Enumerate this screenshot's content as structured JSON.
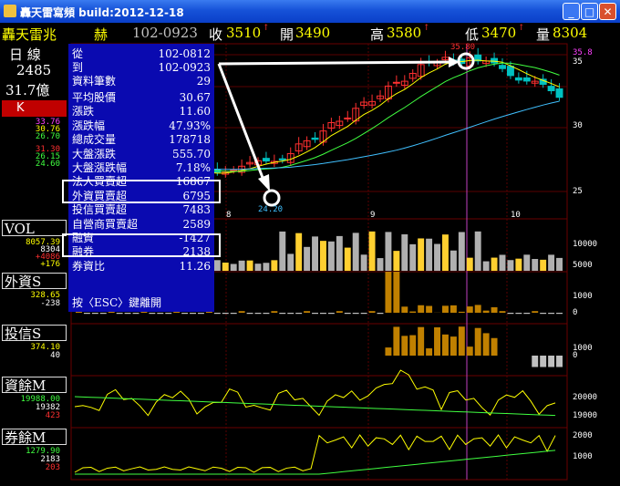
{
  "window": {
    "title": "轟天雷寫頻 build:2012-12-18",
    "min": "_",
    "max": "□",
    "close": "✕"
  },
  "quote": {
    "name": "轟天雷兆",
    "code_mark": "赫",
    "range": "102-0923",
    "close_label": "收",
    "close": "3510",
    "open_label": "開",
    "open": "3490",
    "high_label": "高",
    "high": "3580",
    "low_label": "低",
    "low": "3470",
    "vol_label": "量",
    "vol": "8304"
  },
  "left": {
    "period": "日 線",
    "volume": "2485",
    "amount": "31.7億",
    "k_label": "K",
    "k_values": [
      {
        "v": "33.76",
        "c": "#ff40ff"
      },
      {
        "v": "30.76",
        "c": "#ffff00"
      },
      {
        "v": "26.70",
        "c": "#40ff40"
      },
      {
        "v": "31.30",
        "c": "#ff3030"
      },
      {
        "v": "26.15",
        "c": "#40ff40"
      },
      {
        "v": "24.60",
        "c": "#40ff40"
      }
    ],
    "vol_label": "VOL",
    "vol_values": [
      {
        "v": "8057.39",
        "c": "#ffff00"
      },
      {
        "v": "8304",
        "c": "#fff"
      },
      {
        "v": "+4086",
        "c": "#ff3030"
      },
      {
        "v": "+176",
        "c": "#ffff00"
      }
    ],
    "foreign_label": "外資S",
    "foreign_values": [
      {
        "v": "328.65",
        "c": "#ffff00"
      },
      {
        "v": "-238",
        "c": "#fff"
      }
    ],
    "trust_label": "投信S",
    "trust_values": [
      {
        "v": "374.10",
        "c": "#ffff00"
      },
      {
        "v": "40",
        "c": "#fff"
      }
    ],
    "margin_label": "資餘M",
    "margin_values": [
      {
        "v": "19988.00",
        "c": "#40ff40"
      },
      {
        "v": "19382",
        "c": "#fff"
      },
      {
        "v": "423",
        "c": "#ff3030"
      }
    ],
    "short_label": "券餘M",
    "short_values": [
      {
        "v": "1279.90",
        "c": "#40ff40"
      },
      {
        "v": "2183",
        "c": "#fff"
      },
      {
        "v": "203",
        "c": "#ff3030"
      }
    ]
  },
  "panel": {
    "from_label": "從",
    "from": "102-0812",
    "to_label": "到",
    "to": "102-0923",
    "count_label": "資料筆數",
    "count": "29",
    "rows": [
      {
        "k": "平均股價",
        "v": "30.67"
      },
      {
        "k": "漲跌",
        "v": "11.60"
      },
      {
        "k": "漲跌幅",
        "v": "47.93%"
      },
      {
        "k": "總成交量",
        "v": "178718"
      },
      {
        "k": "大盤漲跌",
        "v": "555.70"
      },
      {
        "k": "大盤漲跌幅",
        "v": "7.18%"
      },
      {
        "k": "法人買賣超",
        "v": "16867"
      },
      {
        "k": "外資買賣超",
        "v": "6795"
      },
      {
        "k": "投信買賣超",
        "v": "7483"
      },
      {
        "k": "自營商買賣超",
        "v": "2589"
      },
      {
        "k": "融資",
        "v": "-1427"
      },
      {
        "k": "融券",
        "v": "2138"
      },
      {
        "k": "券資比",
        "v": "11.26"
      }
    ],
    "esc": "按〈ESC〉鍵離開"
  },
  "chart": {
    "high_mark": "35.80",
    "low_mark": "24.20",
    "top_right": "35.8",
    "price_ticks": [
      "35",
      "30",
      "25"
    ],
    "months": [
      "8",
      "9",
      "10"
    ],
    "vol_ticks": [
      "10000",
      "5000"
    ],
    "foreign_ticks": [
      "1000",
      "0"
    ],
    "trust_ticks": [
      "1000",
      "0"
    ],
    "margin_ticks": [
      "20000",
      "19000"
    ],
    "short_ticks": [
      "2000",
      "1000"
    ]
  },
  "colors": {
    "up": "#ff3030",
    "down": "#00c0c0",
    "ma5": "#ffff00",
    "ma20": "#40ff40",
    "ma60": "#40c0ff",
    "grid": "#5a0000"
  }
}
